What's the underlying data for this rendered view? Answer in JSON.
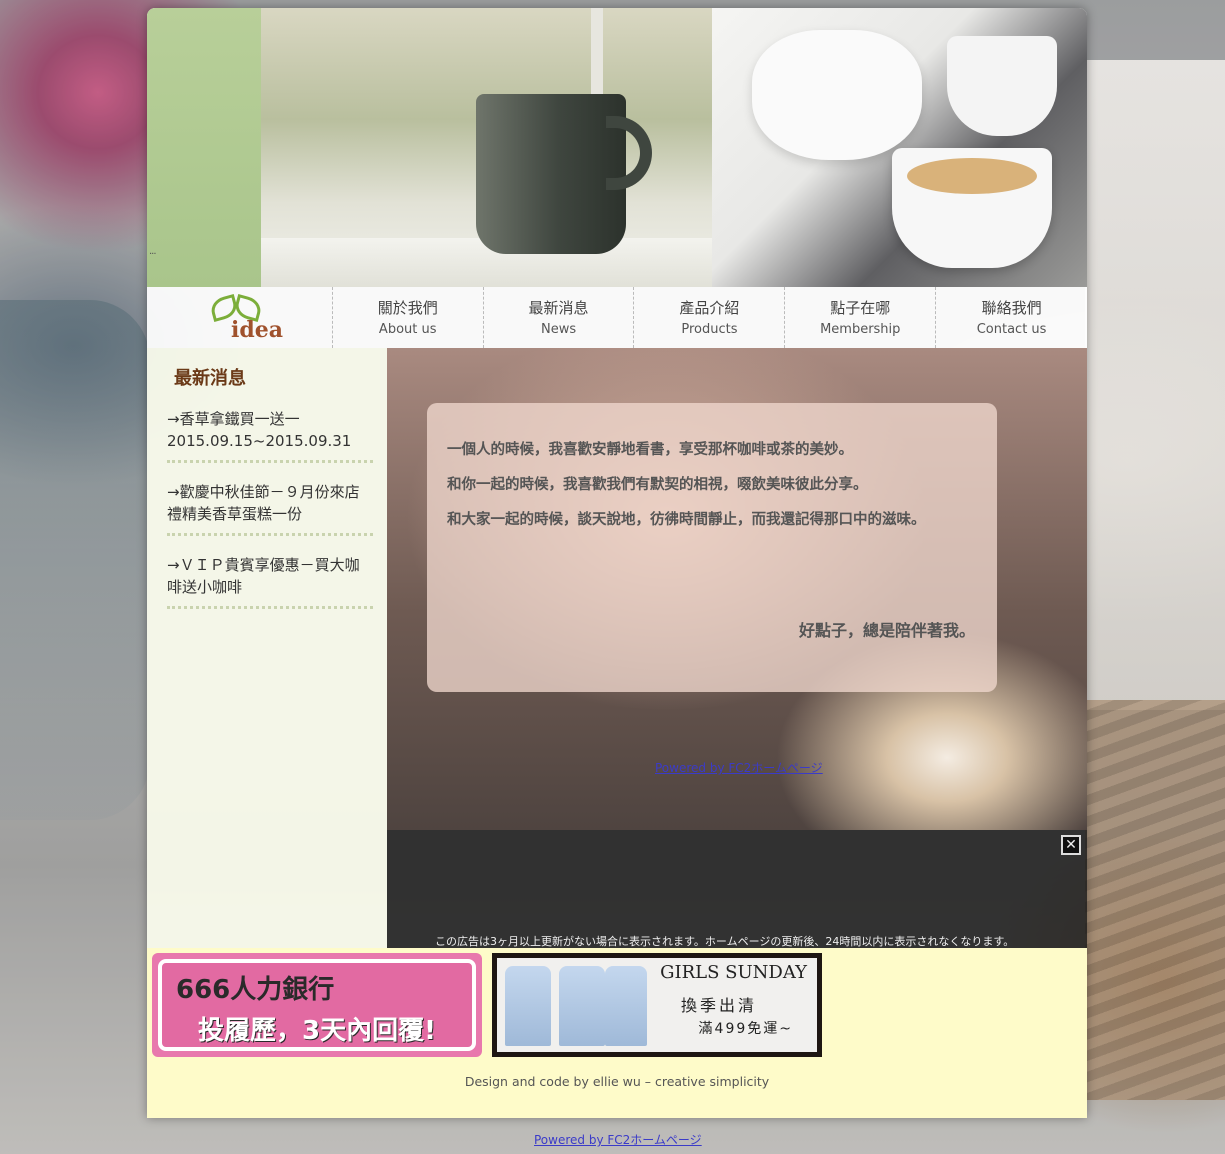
{
  "nav": {
    "items": [
      {
        "zh": "關於我們",
        "en": "About us"
      },
      {
        "zh": "最新消息",
        "en": "News"
      },
      {
        "zh": "產品介紹",
        "en": "Products"
      },
      {
        "zh": "點子在哪",
        "en": "Membership"
      },
      {
        "zh": "聯絡我們",
        "en": "Contact us"
      }
    ]
  },
  "logo": {
    "text": "idea"
  },
  "sidebar": {
    "title": "最新消息",
    "news": [
      {
        "text": "→香草拿鐵買一送一2015.09.15~2015.09.31"
      },
      {
        "text": "→歡慶中秋佳節－９月份來店禮精美香草蛋糕一份"
      },
      {
        "text": "→ＶＩＰ貴賓享優惠－買大咖啡送小咖啡"
      }
    ]
  },
  "main": {
    "quote_lines": [
      "一個人的時候，我喜歡安靜地看書，享受那杯咖啡或茶的美妙。",
      "和你一起的時候，我喜歡我們有默契的相視，啜飲美味彼此分享。",
      "和大家一起的時候，談天說地，彷彿時間靜止，而我還記得那口中的滋味。"
    ],
    "signature": "好點子，總是陪伴著我。",
    "powered_link": "Powered by FC2ホームページ"
  },
  "ad": {
    "close_symbol": "✕",
    "notice": "この広告は3ヶ月以上更新がない場合に表示されます。ホームページの更新後、24時間以内に表示されなくなります。"
  },
  "footer": {
    "ad1": {
      "line1": "666人力銀行",
      "line2": "投履歷，3天內回覆!"
    },
    "ad2": {
      "brand": "GIRLS SUNDAY",
      "line1": "換季出清",
      "line2": "滿499免運~"
    },
    "credit": "Design and code by ellie wu – creative simplicity"
  },
  "bottom_link": "Powered by FC2ホームページ",
  "banner": {
    "dots": "..."
  }
}
